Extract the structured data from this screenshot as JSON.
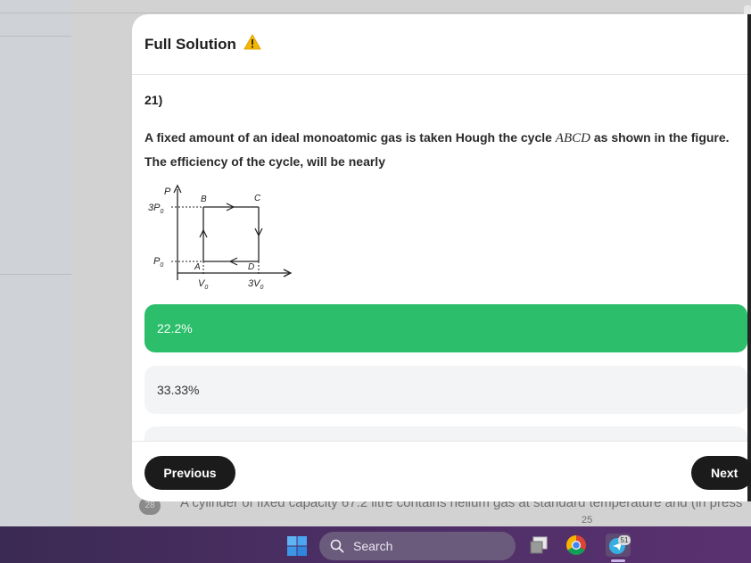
{
  "modal": {
    "title": "Full Solution",
    "question_number": "21)",
    "question_text_1": "A fixed amount of an ideal monoatomic gas is taken Hough the cycle ",
    "question_text_cycle": "ABCD",
    "question_text_2": " as shown in the figure. The efficiency of the cycle, will be nearly",
    "figure_labels": {
      "p_axis": "P",
      "three_p0": "3P",
      "p0": "P",
      "subscript_zero": "0",
      "point_a": "A",
      "point_b": "B",
      "point_c": "C",
      "point_d": "D",
      "v0": "V",
      "three_v0": "3V"
    },
    "options": [
      {
        "label": "22.2%",
        "selected": true
      },
      {
        "label": "33.33%",
        "selected": false
      }
    ],
    "previous_label": "Previous",
    "next_label": "Next"
  },
  "background": {
    "question_number": "28",
    "text": "A cylinder of fixed capacity 67.2 litre contains helium gas at standard temperature and (in press",
    "sub_number": "25"
  },
  "taskbar": {
    "search_label": "Search",
    "telegram_badge": "51"
  },
  "colors": {
    "correct": "#2dbe6c",
    "option_bg": "#f3f4f6",
    "button_dark": "#1b1b1b",
    "warning": "#f2b705"
  }
}
